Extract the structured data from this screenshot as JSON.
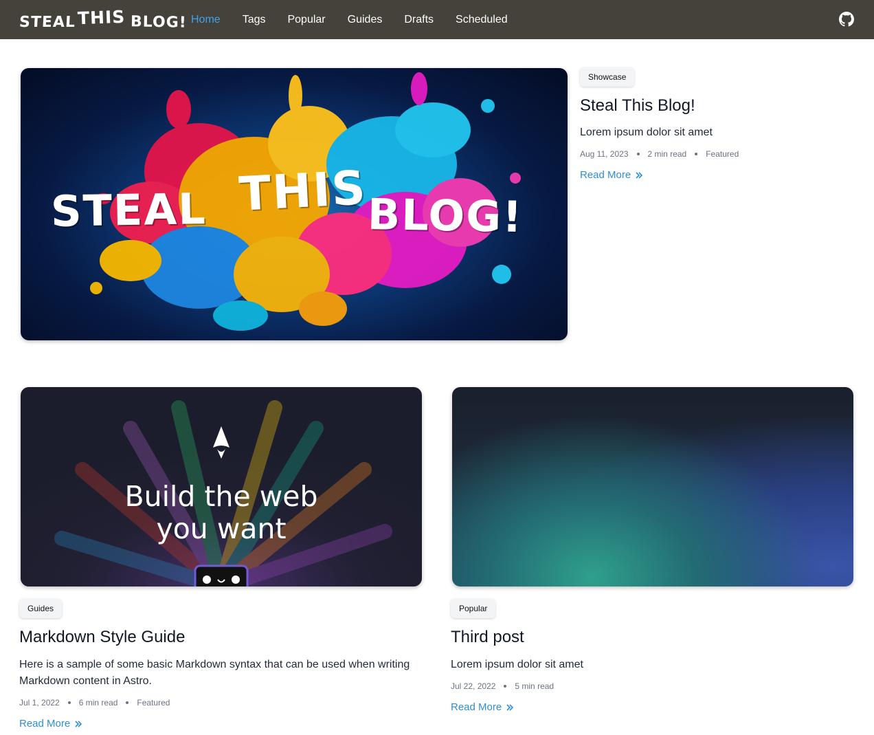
{
  "nav": {
    "logo": {
      "w1": "STEAL",
      "w2": "THIS",
      "w3": "BLOG!"
    },
    "links": [
      "Home",
      "Tags",
      "Popular",
      "Guides",
      "Drafts",
      "Scheduled"
    ],
    "active": "Home",
    "github_icon": "github-icon"
  },
  "colors": {
    "nav_bg": "#45413b",
    "accent": "#3ea3ea",
    "link": "#2b8fd6"
  },
  "posts": [
    {
      "image_text": {
        "w1": "STEAL",
        "w2": "THIS",
        "w3": "BLOG!"
      },
      "tag": "Showcase",
      "title": "Steal This Blog!",
      "description": "Lorem ipsum dolor sit amet",
      "date": "Aug 11, 2023",
      "read_time": "2 min read",
      "featured": "Featured",
      "read_more": "Read More"
    },
    {
      "image_text": "Build the web you want",
      "tag": "Guides",
      "title": "Markdown Style Guide",
      "description": "Here is a sample of some basic Markdown syntax that can be used when writing Markdown content in Astro.",
      "date": "Jul 1, 2022",
      "read_time": "6 min read",
      "featured": "Featured",
      "read_more": "Read More"
    },
    {
      "tag": "Popular",
      "title": "Third post",
      "description": "Lorem ipsum dolor sit amet",
      "date": "Jul 22, 2022",
      "read_time": "5 min read",
      "read_more": "Read More"
    }
  ]
}
